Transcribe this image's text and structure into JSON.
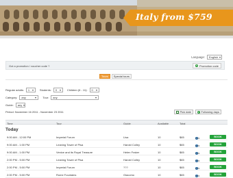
{
  "banner": {
    "promo": "Italy from $759"
  },
  "language": {
    "label": "Language:",
    "value": "English"
  },
  "promotion": {
    "question": "Got a promotion / voucher code ?",
    "button": "Promotion code"
  },
  "tabs": [
    {
      "label": "Tours",
      "active": true
    },
    {
      "label": "Special tours",
      "active": false
    }
  ],
  "filters": {
    "regular_label": "Regular adults:",
    "regular_value": "1",
    "students_label": "Students:",
    "students_value": "0",
    "children_label": "Children (6 - 11):",
    "children_value": "0",
    "category_label": "Category:",
    "category_value": "any",
    "tour_label": "Tour:",
    "tour_value": "any",
    "guide_label": "Guide:",
    "guide_value": "any"
  },
  "period": {
    "text": "Period: November 16 2011 - November 23 2011",
    "pick_date": "Pick date",
    "following": "Following days"
  },
  "table": {
    "headers": {
      "time": "Time",
      "tour": "Tour",
      "guide": "Guide",
      "available": "Available",
      "total": "Total"
    },
    "section": "Today",
    "rows": [
      {
        "time": "9:00 AM - 12:00 PM",
        "tour": "Imperial Forum",
        "guide": "Lisa",
        "available": "10",
        "total": "$65",
        "info": "Info",
        "book": "BOOK"
      },
      {
        "time": "9:00 AM - 1:00 PM",
        "tour": "Leaning Tower of Pisa",
        "guide": "Harold Colley",
        "available": "10",
        "total": "$65",
        "info": "Info",
        "book": "BOOK"
      },
      {
        "time": "9:00 AM - 1:00 PM",
        "tour": "Venice and its Royal Treasure",
        "guide": "Helen Fraker",
        "available": "10",
        "total": "$65",
        "info": "Info",
        "book": "BOOK"
      },
      {
        "time": "2:00 PM - 5:00 PM",
        "tour": "Leaning Tower of Pisa",
        "guide": "Harold Colley",
        "available": "10",
        "total": "$65",
        "info": "Info",
        "book": "BOOK"
      },
      {
        "time": "2:00 PM - 5:00 PM",
        "tour": "Imperial Forum",
        "guide": "???",
        "available": "10",
        "total": "$65",
        "info": "Info",
        "book": "BOOK"
      },
      {
        "time": "2:00 PM - 5:00 PM",
        "tour": "Rome Fountains",
        "guide": "Giacomo",
        "available": "10",
        "total": "$65",
        "info": "Info",
        "book": "BOOK"
      }
    ]
  },
  "colors": {
    "accent": "#e8961c",
    "book": "#23a33a",
    "header_bg": "#eef0f2"
  }
}
